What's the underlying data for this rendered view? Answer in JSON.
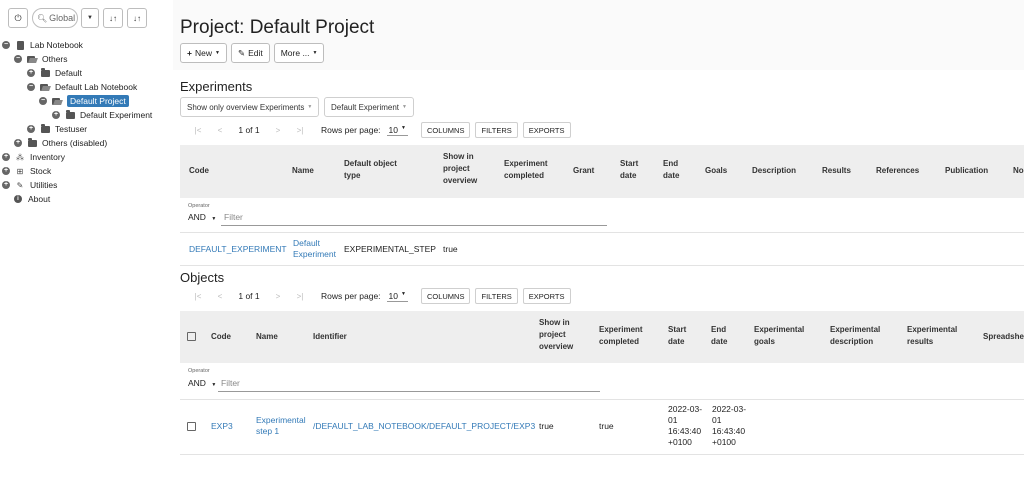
{
  "sidebar": {
    "search_placeholder": "Global",
    "tree": [
      {
        "label": "Lab Notebook"
      },
      {
        "label": "Others"
      },
      {
        "label": "Default"
      },
      {
        "label": "Default Lab Notebook"
      },
      {
        "label": "Default Project"
      },
      {
        "label": "Default Experiment"
      },
      {
        "label": "Testuser"
      },
      {
        "label": "Others (disabled)"
      },
      {
        "label": "Inventory"
      },
      {
        "label": "Stock"
      },
      {
        "label": "Utilities"
      },
      {
        "label": "About"
      }
    ]
  },
  "header": {
    "title": "Project: Default Project",
    "new_label": "New",
    "edit_label": "Edit",
    "more_label": "More ..."
  },
  "experiments": {
    "title": "Experiments",
    "overview_dropdown": "Show only overview Experiments",
    "type_dropdown": "Default Experiment",
    "page_info": "1 of 1",
    "rows_label": "Rows per page:",
    "rows_value": "10",
    "columns_btn": "COLUMNS",
    "filters_btn": "FILTERS",
    "exports_btn": "EXPORTS",
    "columns": [
      "Code",
      "Name",
      "Default object type",
      "Show in project overview",
      "Experiment completed",
      "Grant",
      "Start date",
      "End date",
      "Goals",
      "Description",
      "Results",
      "References",
      "Publication",
      "No"
    ],
    "operator_label": "Operator",
    "operator_value": "AND",
    "filter_placeholder": "Filter",
    "row": {
      "code": "DEFAULT_EXPERIMENT",
      "name": "Default Experiment",
      "type": "EXPERIMENTAL_STEP",
      "overview": "true"
    }
  },
  "objects": {
    "title": "Objects",
    "page_info": "1 of 1",
    "rows_label": "Rows per page:",
    "rows_value": "10",
    "columns_btn": "COLUMNS",
    "filters_btn": "FILTERS",
    "exports_btn": "EXPORTS",
    "columns": [
      "Code",
      "Name",
      "Identifier",
      "Show in project overview",
      "Experiment completed",
      "Start date",
      "End date",
      "Experimental goals",
      "Experimental description",
      "Experimental results",
      "Spreadshe"
    ],
    "operator_label": "Operator",
    "operator_value": "AND",
    "filter_placeholder": "Filter",
    "row": {
      "code": "EXP3",
      "name": "Experimental step 1",
      "identifier": "/DEFAULT_LAB_NOTEBOOK/DEFAULT_PROJECT/EXP3",
      "overview": "true",
      "completed": "true",
      "start_date": "2022-03-01 16:43:40 +0100",
      "end_date": "2022-03-01 16:43:40 +0100"
    }
  },
  "colors": {
    "link": "#337ab7",
    "selected": "#337ab7",
    "header_bg": "#eeeeee"
  }
}
